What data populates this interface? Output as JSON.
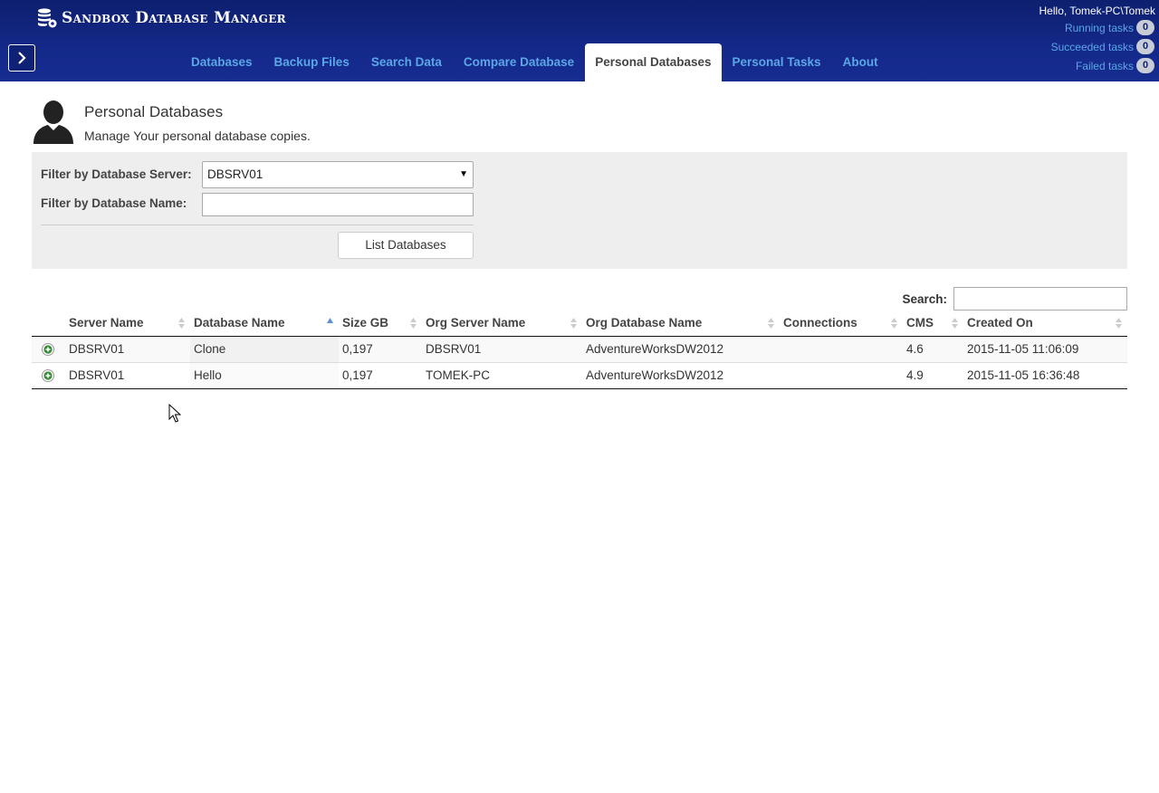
{
  "app": {
    "title": "Sandbox Database Manager"
  },
  "nav": {
    "items": [
      {
        "label": "Databases",
        "active": false
      },
      {
        "label": "Backup Files",
        "active": false
      },
      {
        "label": "Search Data",
        "active": false
      },
      {
        "label": "Compare Database",
        "active": false
      },
      {
        "label": "Personal Databases",
        "active": true
      },
      {
        "label": "Personal Tasks",
        "active": false
      },
      {
        "label": "About",
        "active": false
      }
    ]
  },
  "user": {
    "greeting": "Hello, Tomek-PC\\Tomek",
    "tasks": [
      {
        "label": "Running tasks",
        "count": "0"
      },
      {
        "label": "Succeeded tasks",
        "count": "0"
      },
      {
        "label": "Failed tasks",
        "count": "0"
      }
    ]
  },
  "page": {
    "title": "Personal Databases",
    "subtitle": "Manage Your personal database copies."
  },
  "filters": {
    "server_label": "Filter by Database Server:",
    "server_value": "DBSRV01",
    "name_label": "Filter by Database Name:",
    "name_value": "",
    "list_button": "List Databases"
  },
  "table": {
    "search_label": "Search:",
    "search_value": "",
    "columns": [
      "Server Name",
      "Database Name",
      "Size GB",
      "Org Server Name",
      "Org Database Name",
      "Connections",
      "CMS",
      "Created On"
    ],
    "rows": [
      [
        "DBSRV01",
        "Clone",
        "0,197",
        "DBSRV01",
        "AdventureWorksDW2012",
        "",
        "4.6",
        "2015-11-05 11:06:09"
      ],
      [
        "DBSRV01",
        "Hello",
        "0,197",
        "TOMEK-PC",
        "AdventureWorksDW2012",
        "",
        "4.9",
        "2015-11-05 16:36:48"
      ]
    ]
  },
  "colors": {
    "header_bg": "#14298a",
    "nav_link": "#5ba7e6",
    "expand_green": "#3a8a3a"
  }
}
